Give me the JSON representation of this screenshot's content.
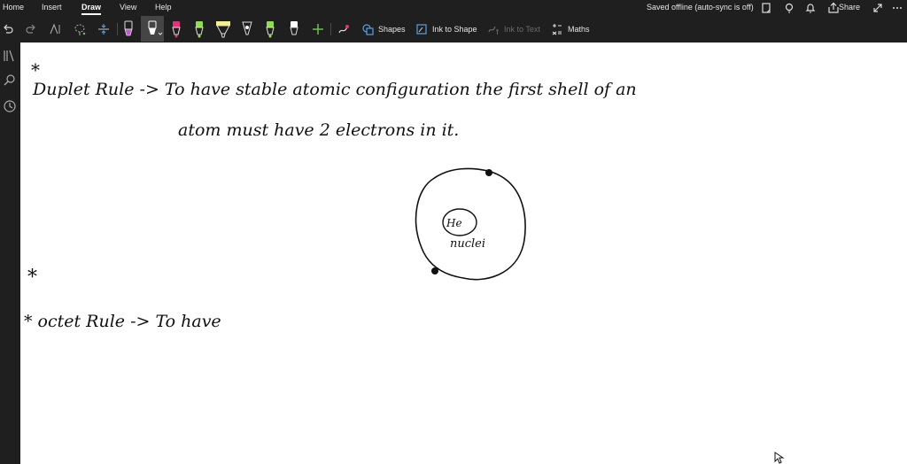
{
  "menu": {
    "home": "Home",
    "insert": "Insert",
    "draw": "Draw",
    "view": "View",
    "help": "Help"
  },
  "status": "Saved offline (auto-sync is off)",
  "titlebar": {
    "share": "Share"
  },
  "toolbar": {
    "shapes": "Shapes",
    "ink_to_shape": "Ink to Shape",
    "ink_to_text": "Ink to Text",
    "maths": "Maths",
    "pens": [
      {
        "color": "#c25bd6"
      },
      {
        "color": "#ffffff"
      },
      {
        "color": "#e0337a"
      },
      {
        "color": "#8ee04a"
      },
      {
        "color": "#f4f08a"
      },
      {
        "color": "#ffffff"
      },
      {
        "color": "#8ee04a"
      },
      {
        "color": "#ffffff"
      }
    ]
  },
  "note": {
    "line1_a": "*",
    "line1_b": "Duplet Rule ->  To  have   stable  atomic  configuration     the  first  shell  of  an",
    "line2": "atom  must  have   2 electrons  in  it.",
    "nucleus": "He",
    "nucleus_label": "nuclei",
    "star2": "*",
    "line3": "* octet   Rule ->  To  have"
  }
}
